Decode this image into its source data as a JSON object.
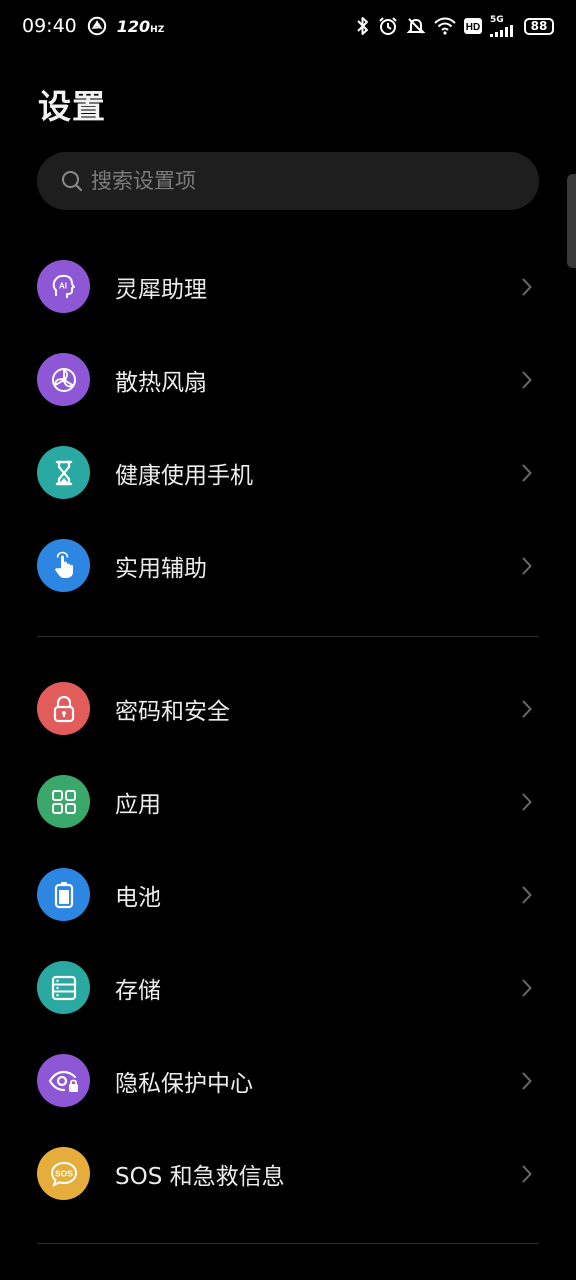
{
  "status_bar": {
    "time": "09:40",
    "refresh_rate": "120",
    "network": "5G",
    "battery": "88"
  },
  "page": {
    "title": "设置"
  },
  "search": {
    "placeholder": "搜索设置项"
  },
  "groups": [
    {
      "items": [
        {
          "label": "灵犀助理",
          "icon": "ai-assistant-icon",
          "color": "#8e57d6"
        },
        {
          "label": "散热风扇",
          "icon": "fan-icon",
          "color": "#8e57d6"
        },
        {
          "label": "健康使用手机",
          "icon": "hourglass-icon",
          "color": "#2aa8a2"
        },
        {
          "label": "实用辅助",
          "icon": "hand-pointer-icon",
          "color": "#2e86e3"
        }
      ]
    },
    {
      "items": [
        {
          "label": "密码和安全",
          "icon": "lock-icon",
          "color": "#e35c5c"
        },
        {
          "label": "应用",
          "icon": "apps-grid-icon",
          "color": "#3aa86a"
        },
        {
          "label": "电池",
          "icon": "battery-icon",
          "color": "#2e86e3"
        },
        {
          "label": "存储",
          "icon": "storage-icon",
          "color": "#2aa8a2"
        },
        {
          "label": "隐私保护中心",
          "icon": "privacy-eye-icon",
          "color": "#8e57d6"
        },
        {
          "label": "SOS 和急救信息",
          "icon": "sos-icon",
          "color": "#e5ae3c"
        }
      ]
    }
  ]
}
